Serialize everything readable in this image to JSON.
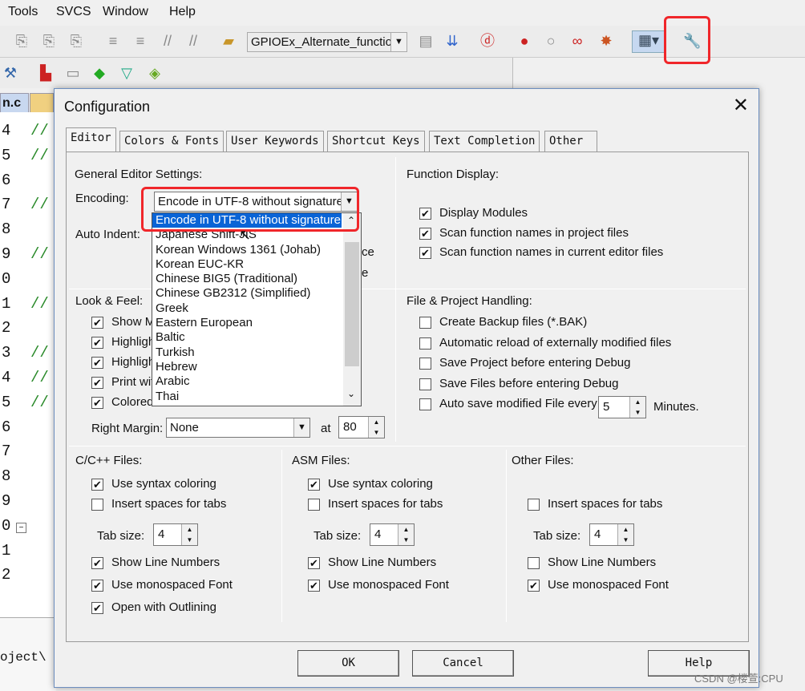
{
  "menu": [
    "Tools",
    "SVCS",
    "Window",
    "Help"
  ],
  "toolbar": {
    "project_combo": "GPIOEx_Alternate_functio"
  },
  "editor_tabs": [
    "n.c"
  ],
  "editor": {
    "line_numbers": [
      "4",
      "5",
      "6",
      "7",
      "8",
      "9",
      "0",
      "1",
      "2",
      "3",
      "4",
      "5",
      "6",
      "7",
      "8",
      "9",
      "0",
      "1",
      "2"
    ],
    "comment": "//",
    "comment_lines": [
      0,
      1,
      3,
      5,
      7,
      9,
      10,
      11
    ]
  },
  "output": {
    "text": "oject\\"
  },
  "dialog": {
    "title": "Configuration",
    "tabs": [
      "Editor",
      "Colors & Fonts",
      "User Keywords",
      "Shortcut Keys",
      "Text Completion",
      "Other"
    ],
    "general": {
      "heading": "General Editor Settings:",
      "encoding_label": "Encoding:",
      "encoding_value": "Encode in UTF-8 without signature",
      "auto_indent_label": "Auto Indent:",
      "hidden_partial": [
        "ce",
        "e"
      ]
    },
    "encoding_options": [
      "Encode in UTF-8 without signature",
      "Japanese Shift-JIS",
      "Korean Windows 1361 (Johab)",
      "Korean EUC-KR",
      "Chinese BIG5 (Traditional)",
      "Chinese GB2312 (Simplified)",
      "Greek",
      "Eastern European",
      "Baltic",
      "Turkish",
      "Hebrew",
      "Arabic",
      "Thai"
    ],
    "function_display": {
      "heading": "Function Display:",
      "items": [
        {
          "label": "Display Modules",
          "checked": true
        },
        {
          "label": "Scan function names in project files",
          "checked": true
        },
        {
          "label": "Scan function names in current editor files",
          "checked": true
        }
      ]
    },
    "look_feel": {
      "heading": "Look & Feel:",
      "items": [
        {
          "label": "Show M",
          "checked": true
        },
        {
          "label": "Highligh",
          "checked": true
        },
        {
          "label": "Highligh",
          "checked": true
        },
        {
          "label": "Print wit",
          "checked": true
        },
        {
          "label": "Colored Editor Tabs",
          "checked": true
        }
      ],
      "right_margin_label": "Right Margin:",
      "right_margin_value": "None",
      "at_label": "at",
      "at_value": "80"
    },
    "file_project": {
      "heading": "File & Project Handling:",
      "items": [
        {
          "label": "Create Backup files (*.BAK)",
          "checked": false
        },
        {
          "label": "Automatic reload of externally modified files",
          "checked": false
        },
        {
          "label": "Save Project before entering Debug",
          "checked": false
        },
        {
          "label": "Save Files before entering Debug",
          "checked": false
        },
        {
          "label": "Auto save modified File every",
          "checked": false
        }
      ],
      "autosave_value": "5",
      "minutes_label": "Minutes."
    },
    "cpp": {
      "heading": "C/C++ Files:",
      "syntax": "Use syntax coloring",
      "spaces": "Insert spaces for tabs",
      "tab_size_label": "Tab size:",
      "tab_size": "4",
      "line_numbers": "Show Line Numbers",
      "mono": "Use monospaced Font",
      "outlining": "Open with Outlining"
    },
    "asm": {
      "heading": "ASM Files:",
      "syntax": "Use syntax coloring",
      "spaces": "Insert spaces for tabs",
      "tab_size_label": "Tab size:",
      "tab_size": "4",
      "line_numbers": "Show Line Numbers",
      "mono": "Use monospaced Font"
    },
    "other": {
      "heading": "Other Files:",
      "spaces": "Insert spaces for tabs",
      "tab_size_label": "Tab size:",
      "tab_size": "4",
      "line_numbers": "Show Line Numbers",
      "mono": "Use monospaced Font"
    },
    "buttons": {
      "ok": "OK",
      "cancel": "Cancel",
      "help": "Help"
    }
  },
  "watermark": "CSDN @楼萱:CPU",
  "colors": {
    "highlight": "#f0262a",
    "selection": "#0a64d6"
  }
}
